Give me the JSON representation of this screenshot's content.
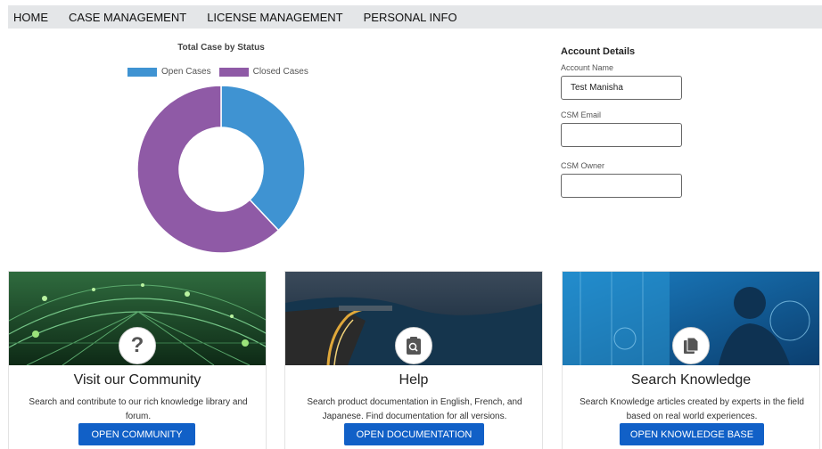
{
  "nav": {
    "items": [
      "HOME",
      "CASE MANAGEMENT",
      "LICENSE MANAGEMENT",
      "PERSONAL INFO"
    ]
  },
  "chart_data": {
    "type": "pie",
    "title": "Total Case by Status",
    "categories": [
      "Open Cases",
      "Closed Cases"
    ],
    "values": [
      38,
      62
    ],
    "colors": [
      "#3f93d2",
      "#8f5aa6"
    ],
    "donut": true,
    "legend": "top"
  },
  "account": {
    "title": "Account Details",
    "name_label": "Account Name",
    "name_value": "Test Manisha",
    "email_label": "CSM Email",
    "email_value": "",
    "owner_label": "CSM Owner",
    "owner_value": ""
  },
  "cards": [
    {
      "title": "Visit our Community",
      "description": "Search and contribute to our rich knowledge library and forum.",
      "button": "OPEN COMMUNITY",
      "icon": "question-icon"
    },
    {
      "title": "Help",
      "description": "Search product documentation in English, French, and Japanese. Find documentation for all versions.",
      "button": "OPEN DOCUMENTATION",
      "icon": "clipboard-search-icon"
    },
    {
      "title": "Search Knowledge",
      "description": "Search Knowledge articles created by experts in the field based on real world experiences.",
      "button": "OPEN KNOWLEDGE BASE",
      "icon": "document-icon"
    }
  ]
}
